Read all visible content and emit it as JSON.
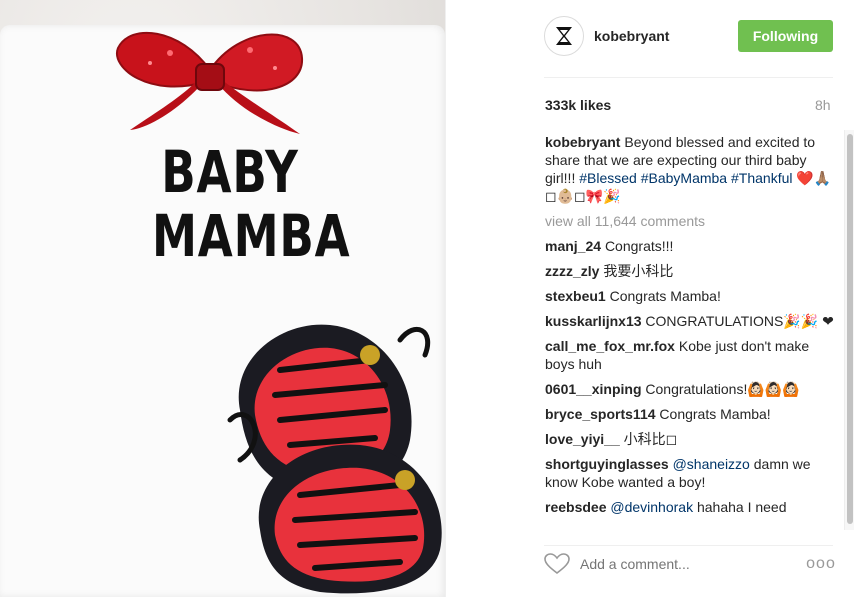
{
  "photo": {
    "onesie_line1": "BABY",
    "onesie_line2": "MAMBA",
    "bow_color": "#c8121b",
    "shoe_color": "#e8323c"
  },
  "header": {
    "username": "kobebryant",
    "follow_label": "Following",
    "follow_color": "#70c050"
  },
  "stats": {
    "likes": "333k likes",
    "time": "8h"
  },
  "caption": {
    "user": "kobebryant",
    "text": "Beyond blessed and excited to share that we are expecting our third baby girl!!!",
    "hashtag1": "#Blessed",
    "hashtag2": "#BabyMamba",
    "hashtag3": "#Thankful",
    "emoji": "❤️🙏🏽◻👶🏼◻🎀🎉"
  },
  "view_all": "view all 11,644 comments",
  "comments": [
    {
      "user": "manj_24",
      "text": "Congrats!!!"
    },
    {
      "user": "zzzz_zly",
      "text": "我要小科比"
    },
    {
      "user": "stexbeu1",
      "text": "Congrats Mamba!"
    },
    {
      "user": "kusskarlijnx13",
      "text": "CONGRATULATIONS🎉🎉 ❤"
    },
    {
      "user": "call_me_fox_mr.fox",
      "text": "Kobe just don't make boys huh"
    },
    {
      "user": "0601__xinping",
      "text": "Congratulations!🙆🏻🙆🏻🙆🏻"
    },
    {
      "user": "bryce_sports114",
      "text": "Congrats Mamba!"
    },
    {
      "user": "love_yiyi__",
      "text": "小科比◻"
    },
    {
      "user": "shortguyinglasses",
      "mention": "@shaneizzo",
      "text": "damn we know Kobe wanted a boy!"
    },
    {
      "user": "reebsdee",
      "mention": "@devinhorak",
      "text": "hahaha I need"
    }
  ],
  "footer": {
    "add_comment_placeholder": "Add a comment...",
    "more_label": "ooo"
  }
}
